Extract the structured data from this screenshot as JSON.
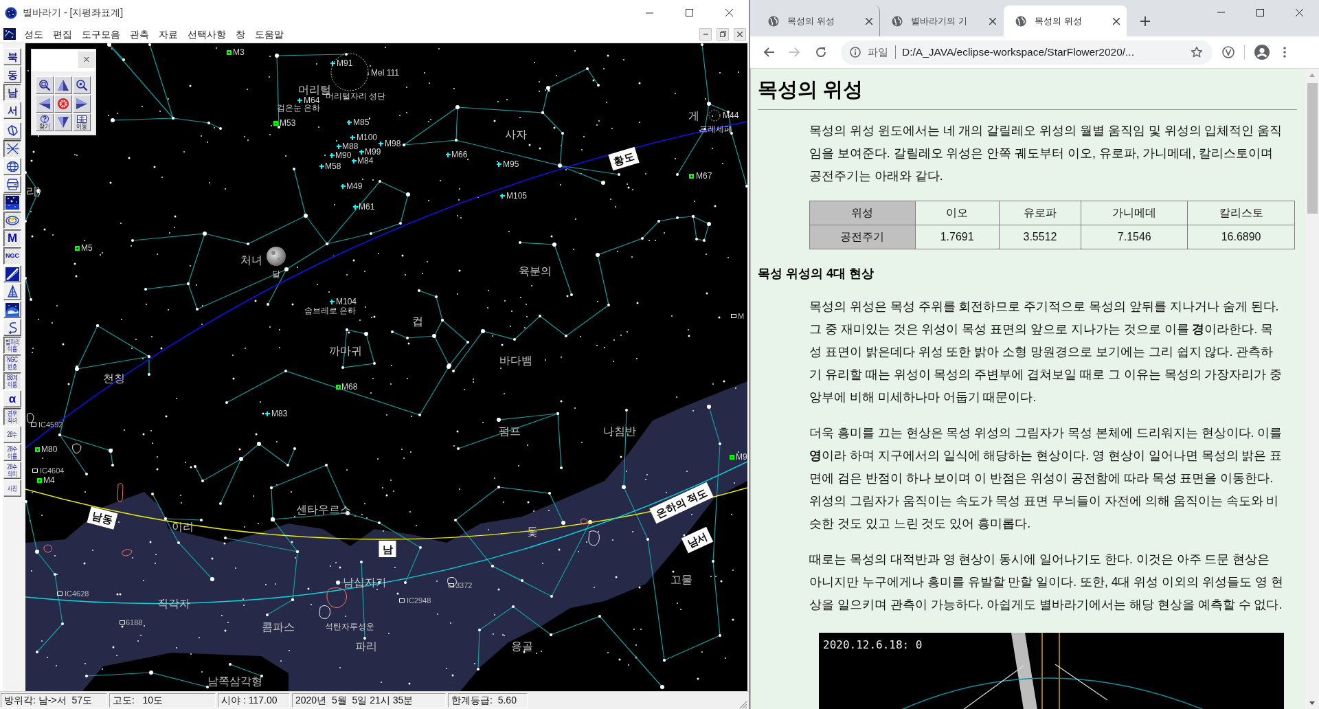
{
  "app": {
    "title": "별바라기 - [지평좌표계]",
    "menu": [
      "성도",
      "편집",
      "도구모음",
      "관측",
      "자료",
      "선택사항",
      "창",
      "도움말"
    ]
  },
  "toolbar": [
    {
      "kind": "direction",
      "label": "북",
      "pressed": false
    },
    {
      "kind": "direction",
      "label": "동",
      "pressed": false
    },
    {
      "kind": "direction",
      "label": "남",
      "pressed": true
    },
    {
      "kind": "direction",
      "label": "서",
      "pressed": false
    },
    {
      "kind": "icon",
      "pressed": false
    },
    {
      "kind": "icon",
      "pressed": true
    },
    {
      "kind": "icon",
      "pressed": false
    },
    {
      "kind": "icon",
      "pressed": false
    },
    {
      "kind": "icon",
      "pressed": true
    },
    {
      "kind": "icon",
      "pressed": true
    },
    {
      "kind": "big",
      "label": "M",
      "pressed": true
    },
    {
      "kind": "big",
      "label": "NGC",
      "pressed": true
    },
    {
      "kind": "icon",
      "pressed": false
    },
    {
      "kind": "icon",
      "pressed": false
    },
    {
      "kind": "icon",
      "pressed": false
    },
    {
      "kind": "icon",
      "pressed": false
    },
    {
      "kind": "small",
      "label": "별자리 이름",
      "pressed": true
    },
    {
      "kind": "small",
      "label": "NGC 번호",
      "pressed": true
    },
    {
      "kind": "small",
      "label": "B8계 이름",
      "pressed": true
    },
    {
      "kind": "big",
      "label": "α",
      "pressed": false
    },
    {
      "kind": "small",
      "label": "견우 직녀",
      "pressed": true
    },
    {
      "kind": "small",
      "label": "28수",
      "pressed": false
    },
    {
      "kind": "small",
      "label": "28수 이름",
      "pressed": false
    },
    {
      "kind": "small",
      "label": "28수 의미",
      "pressed": false
    },
    {
      "kind": "small",
      "label": "사진",
      "pressed": false
    }
  ],
  "sky_map": {
    "navigator": {
      "close": "×",
      "find": "찾기",
      "move": "이동"
    },
    "labels": [
      {
        "kind": "globular",
        "text": "M3",
        "color": "#00ff00"
      },
      {
        "kind": "galaxy",
        "text": "M91",
        "color": "#00ffff"
      },
      {
        "kind": "cluster",
        "text": "Mel 111"
      },
      {
        "kind": "constellation",
        "text": "머리털"
      },
      {
        "kind": "name",
        "text": "머리털자리 성단"
      },
      {
        "kind": "galaxy",
        "text": "M64",
        "color": "#00ffff"
      },
      {
        "kind": "name",
        "text": "검은눈 은하"
      },
      {
        "kind": "globular",
        "text": "M53",
        "color": "#00ff00"
      },
      {
        "kind": "galaxy",
        "text": "M85",
        "color": "#00ffff"
      },
      {
        "kind": "galaxy",
        "text": "M100",
        "color": "#00ffff"
      },
      {
        "kind": "galaxy",
        "text": "M98",
        "color": "#00ffff"
      },
      {
        "kind": "galaxy",
        "text": "M88",
        "color": "#00ffff"
      },
      {
        "kind": "galaxy",
        "text": "M99",
        "color": "#00ffff"
      },
      {
        "kind": "galaxy",
        "text": "M90",
        "color": "#00ffff"
      },
      {
        "kind": "galaxy",
        "text": "M84",
        "color": "#00ffff"
      },
      {
        "kind": "galaxy",
        "text": "M58",
        "color": "#00ffff"
      },
      {
        "kind": "galaxy",
        "text": "M49",
        "color": "#00ffff"
      },
      {
        "kind": "galaxy",
        "text": "M61",
        "color": "#00ffff"
      },
      {
        "kind": "constellation",
        "text": "사자"
      },
      {
        "kind": "galaxy",
        "text": "M66",
        "color": "#00ffff"
      },
      {
        "kind": "galaxy",
        "text": "M95",
        "color": "#00ffff"
      },
      {
        "kind": "galaxy",
        "text": "M105",
        "color": "#00ffff"
      },
      {
        "kind": "line",
        "text": "황도"
      },
      {
        "kind": "constellation",
        "text": "게"
      },
      {
        "kind": "cluster",
        "text": "M44"
      },
      {
        "kind": "name",
        "text": "프레세페"
      },
      {
        "kind": "globular",
        "text": "M67",
        "color": "#00ff00"
      },
      {
        "kind": "constellation",
        "text": "리)"
      },
      {
        "kind": "globular",
        "text": "M5",
        "color": "#00ff00"
      },
      {
        "kind": "constellation",
        "text": "처녀"
      },
      {
        "kind": "name",
        "text": "달"
      },
      {
        "kind": "galaxy",
        "text": "M104",
        "color": "#00ffff"
      },
      {
        "kind": "name",
        "text": "솜브레로 은하"
      },
      {
        "kind": "constellation",
        "text": "육분의"
      },
      {
        "kind": "nebula",
        "text": "M",
        "color": "#ffffff"
      },
      {
        "kind": "constellation",
        "text": "컵"
      },
      {
        "kind": "constellation",
        "text": "까마귀"
      },
      {
        "kind": "constellation",
        "text": "바다뱀"
      },
      {
        "kind": "constellation",
        "text": "천칭"
      },
      {
        "kind": "globular",
        "text": "M68",
        "color": "#00ff00"
      },
      {
        "kind": "galaxy",
        "text": "M83",
        "color": "#00ffff"
      },
      {
        "kind": "nebula",
        "text": "IC4592",
        "color": "#ffffff"
      },
      {
        "kind": "constellation",
        "text": "펌프"
      },
      {
        "kind": "constellation",
        "text": "나침반"
      },
      {
        "kind": "globular",
        "text": "M80",
        "color": "#00ff00"
      },
      {
        "kind": "globular",
        "text": "M9",
        "color": "#00ff00"
      },
      {
        "kind": "nebula",
        "text": "IC4604",
        "color": "#ffffff"
      },
      {
        "kind": "globular",
        "text": "M4",
        "color": "#00ff00"
      },
      {
        "kind": "direction",
        "text": "남동"
      },
      {
        "kind": "constellation",
        "text": "센타우르스"
      },
      {
        "kind": "line",
        "text": "은하의 적도"
      },
      {
        "kind": "direction",
        "text": "남서"
      },
      {
        "kind": "constellation",
        "text": "이리"
      },
      {
        "kind": "constellation",
        "text": "돛"
      },
      {
        "kind": "direction",
        "text": "남"
      },
      {
        "kind": "constellation",
        "text": "남십자가"
      },
      {
        "kind": "nebula",
        "text": "3372",
        "color": "#ffffff"
      },
      {
        "kind": "constellation",
        "text": "고물"
      },
      {
        "kind": "nebula",
        "text": "IC4628",
        "color": "#ffffff"
      },
      {
        "kind": "constellation",
        "text": "직각자"
      },
      {
        "kind": "nebula",
        "text": "IC2948",
        "color": "#ffffff"
      },
      {
        "kind": "nebula",
        "text": "6188",
        "color": "#ffffff"
      },
      {
        "kind": "constellation",
        "text": "콤파스"
      },
      {
        "kind": "name",
        "text": "석탄자루성운"
      },
      {
        "kind": "constellation",
        "text": "파리"
      },
      {
        "kind": "constellation",
        "text": "용골"
      },
      {
        "kind": "constellation",
        "text": "남쪽삼각형"
      }
    ]
  },
  "status_bar": [
    "방위각: 남->서  57도",
    "고도:   10도",
    "시야 : 117.00",
    "2020년  5월  5일 21시 35분",
    "한계등급:  5.60"
  ],
  "browser": {
    "tabs": [
      {
        "title": "목성의 위성",
        "selected": false
      },
      {
        "title": "별바라기의 기",
        "selected": false
      },
      {
        "title": "목성의 위성",
        "selected": true
      }
    ],
    "address": {
      "scheme": "파일",
      "url": "D:/A_JAVA/eclipse-workspace/StarFlower2020/..."
    },
    "page": {
      "title": "목성의 위성",
      "intro": "목성의 위성 윈도에서는 네 개의 갈릴레오 위성의 월별 움직임 및 위성의 입체적인 움직임을 보여준다. 갈릴레오 위성은 안쪽 궤도부터 이오, 유로파, 가니메데, 칼리스토이며 공전주기는 아래와 같다.",
      "table": [
        [
          "위성",
          "이오",
          "유로파",
          "가니메데",
          "칼리스토"
        ],
        [
          "공전주기",
          "1.7691",
          "3.5512",
          "7.1546",
          "16.6890"
        ]
      ],
      "section_title": "목성 위성의 4대 현상",
      "paragraphs": [
        "목성의 위성은 목성 주위를 회전하므로 주기적으로 목성의 앞뒤를 지나거나 숨게 된다. 그 중 재미있는 것은 위성이 목성 표면의 앞으로 지나가는 것으로 이를 **경**이라한다. 목성 표면이 밝은데다 위성 또한 밝아 소형 망원경으로 보기에는 그리 쉽지 않다. 관측하기 유리할 때는 위성이 목성의 주변부에 겹쳐보일 때로 그 이유는 목성의 가장자리가 중앙부에 비해 미세하나마 어둡기 때문이다.",
        "더욱 흥미를 끄는 현상은 목성 위성의 그림자가 목성 본체에 드리워지는 현상이다. 이를 **영**이라 하며 지구에서의 일식에 해당하는 현상이다. 영 현상이 일어나면 목성의 밝은 표면에 검은 반점이 하나 보이며 이 반점은 위성이 공전함에 따라 목성 표면을 이동한다. 위성의 그림자가 움직이는 속도가 목성 표면 무늬들이 자전에 의해 움직이는 속도와 비슷한 것도 있고 느린 것도 있어 흥미롭다.",
        "때로는 목성의 대적반과 영 현상이 동시에 일어나기도 한다. 이것은 아주 드문 현상은 아니지만 누구에게나 흥미를 유발할 만할 일이다. 또한, 4대 위성 이외의 위성들도 영 현상을 일으키며 관측이 가능하다. 아쉽게도 별바라기에서는 해당 현상을 예측할 수 없다."
      ],
      "figure": {
        "timestamp": "2020.12.6.18: 0"
      }
    }
  }
}
